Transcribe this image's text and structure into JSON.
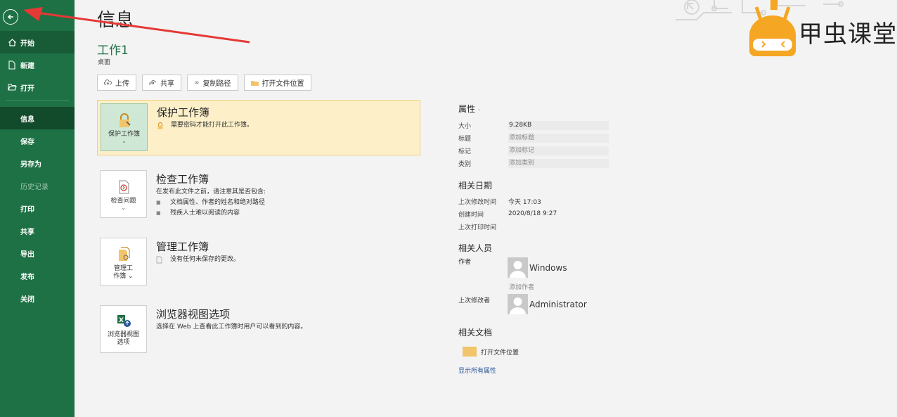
{
  "sidebar": {
    "back_label": "",
    "top_items": [
      {
        "label": "开始",
        "icon": "home-icon"
      },
      {
        "label": "新建",
        "icon": "new-document-icon"
      },
      {
        "label": "打开",
        "icon": "open-folder-icon"
      }
    ],
    "bottom_items": [
      {
        "label": "信息",
        "state": "selected"
      },
      {
        "label": "保存",
        "state": "normal"
      },
      {
        "label": "另存为",
        "state": "normal"
      },
      {
        "label": "历史记录",
        "state": "disabled"
      },
      {
        "label": "打印",
        "state": "normal"
      },
      {
        "label": "共享",
        "state": "normal"
      },
      {
        "label": "导出",
        "state": "normal"
      },
      {
        "label": "发布",
        "state": "normal"
      },
      {
        "label": "关闭",
        "state": "normal"
      }
    ]
  },
  "header": {
    "title": "信息",
    "doc_name": "工作1",
    "doc_path": "桌面"
  },
  "toolbar": {
    "upload": "上传",
    "share": "共享",
    "copy_path": "复制路径",
    "open_location": "打开文件位置"
  },
  "sections": {
    "protect": {
      "tile_label": "保护工作簿",
      "title": "保护工作簿",
      "desc": "需要密码才能打开此工作簿。"
    },
    "inspect": {
      "tile_label": "检查问题",
      "title": "检查工作簿",
      "desc": "在发布此文件之前，请注意其是否包含:",
      "bullets": [
        "文档属性、作者的姓名和绝对路径",
        "残疾人士难以阅读的内容"
      ]
    },
    "manage": {
      "tile_label_1": "管理工",
      "tile_label_2": "作簿",
      "title": "管理工作簿",
      "desc": "没有任何未保存的更改。"
    },
    "browser": {
      "tile_label_1": "浏览器视图",
      "tile_label_2": "选项",
      "title": "浏览器视图选项",
      "desc": "选择在 Web 上查看此工作簿时用户可以看到的内容。"
    }
  },
  "properties": {
    "heading": "属性",
    "rows": [
      {
        "key": "大小",
        "value": "9.28KB"
      },
      {
        "key": "标题",
        "value": "添加标题"
      },
      {
        "key": "标记",
        "value": "添加标记"
      },
      {
        "key": "类别",
        "value": "添加类别"
      }
    ]
  },
  "dates": {
    "heading": "相关日期",
    "rows": [
      {
        "key": "上次修改时间",
        "value": "今天 17:03"
      },
      {
        "key": "创建时间",
        "value": "2020/8/18 9:27"
      },
      {
        "key": "上次打印时间",
        "value": ""
      }
    ]
  },
  "people": {
    "heading": "相关人员",
    "author_key": "作者",
    "author_name": "Windows",
    "add_author": "添加作者",
    "modifier_key": "上次修改者",
    "modifier_name": "Administrator"
  },
  "related_docs": {
    "heading": "相关文档",
    "open_location": "打开文件位置",
    "show_all": "显示所有属性"
  },
  "watermark": {
    "text": "甲虫课堂"
  },
  "colors": {
    "sidebar": "#1e7145",
    "accent": "#1e7145",
    "highlight": "#fdf0c9",
    "annotation_arrow": "#e53935",
    "logo_orange": "#f5a623"
  }
}
